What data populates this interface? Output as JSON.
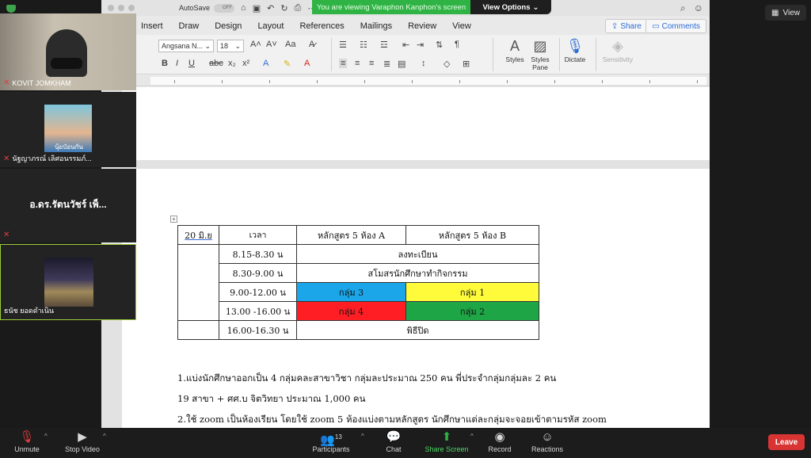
{
  "zoom": {
    "view_label": "View",
    "banner_text": "You are viewing Varaphon Kanphon's screen",
    "view_options_label": "View Options"
  },
  "word": {
    "autosave_label": "AutoSave",
    "autosave_state": "OFF",
    "tabs": [
      "Insert",
      "Draw",
      "Design",
      "Layout",
      "References",
      "Mailings",
      "Review",
      "View"
    ],
    "share_label": "Share",
    "comments_label": "Comments",
    "font_name": "Angsana N...",
    "font_size": "18",
    "styles_label": "Styles",
    "styles_pane_label": "Styles Pane",
    "dictate_label": "Dictate",
    "sensitivity_label": "Sensitivity"
  },
  "document": {
    "table": {
      "header": [
        "20 มิ.ย",
        "เวลา",
        "หลักสูตร 5 ห้อง A",
        "หลักสูตร 5 ห้อง B"
      ],
      "rows": [
        {
          "time": "8.15-8.30 น",
          "merged": "ลงทะเบียน"
        },
        {
          "time": "8.30-9.00 น",
          "merged": "สโมสรนักศึกษาทำกิจกรรม"
        },
        {
          "time": "9.00-12.00 น",
          "a": "กลุ่ม 3",
          "b": "กลุ่ม 1"
        },
        {
          "time": "13.00 -16.00 น",
          "a": "กลุ่ม 4",
          "b": "กลุ่ม 2"
        },
        {
          "time": "16.00-16.30 น",
          "merged": "พิธีปิด"
        }
      ]
    },
    "paragraphs": [
      "1.แบ่งนักศึกษาออกเป็น 4 กลุ่มคละสาขาวิชา กลุ่มละประมาณ 250 คน พี่ประจำกลุ่มกลุ่มละ 2 คน",
      "19 สาขา + ศศ.บ จิตวิทยา ประมาณ 1,000 คน",
      "2.ใช้ zoom เป็นห้องเรียน โดยใช้ zoom  5 ห้องแบ่งตามหลักสูตร นักศึกษาแต่ละกลุ่มจะจอยเข้าตามรหัส zoom"
    ]
  },
  "participants_gallery": [
    {
      "name": "KOVIT JOMKHAM"
    },
    {
      "name": "นัฐญาภรณ์ เลิศอนรรมภ์...",
      "photo_caption": "นุ้ยป๋อนกัน"
    },
    {
      "name": "อ.ดร.รัตนวัชร์ เพ็..."
    },
    {
      "name": "ธนัช ยอดดำเนิน"
    }
  ],
  "toolbar": {
    "unmute": "Unmute",
    "stop_video": "Stop Video",
    "participants": "Participants",
    "participants_count": "13",
    "chat": "Chat",
    "share_screen": "Share Screen",
    "record": "Record",
    "reactions": "Reactions",
    "leave": "Leave"
  },
  "colors": {
    "group_blue": "#1aa6e8",
    "group_yellow": "#fffb3a",
    "group_red": "#ff1e24",
    "group_green": "#1ea545",
    "share_green": "#2fb344",
    "leave_red": "#d93434"
  }
}
